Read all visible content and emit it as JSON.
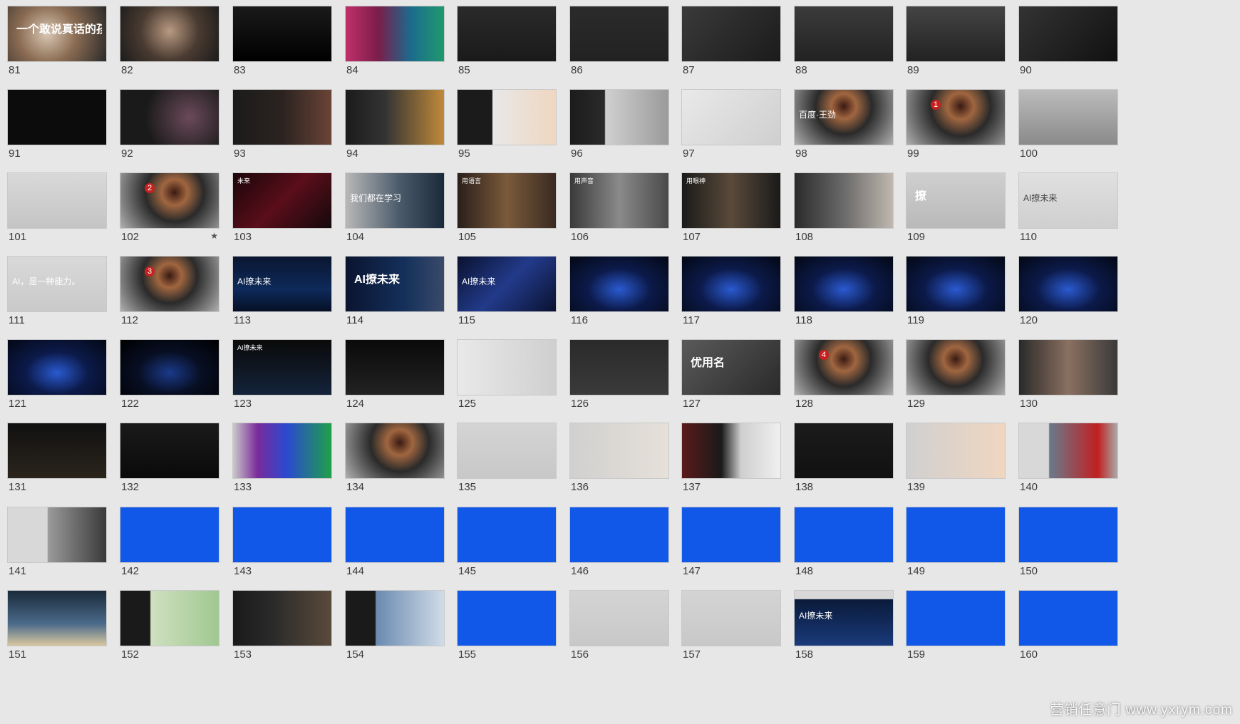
{
  "watermark": "营销任意门 www.yxrym.com",
  "slides": [
    {
      "num": "81",
      "bg": "radial-gradient(circle at 40% 50%, #d9c7b3 0%, #8a6b52 45%, #2a2a2a 100%)",
      "text": "一个敢说真话的孩子",
      "cls": "big"
    },
    {
      "num": "82",
      "bg": "radial-gradient(circle at 50% 45%, #b89a82 0%, #4a3b31 50%, #1b1b1b 100%)",
      "text": "",
      "cls": ""
    },
    {
      "num": "83",
      "bg": "linear-gradient(180deg,#1a1a1a,#000)",
      "text": "",
      "cls": ""
    },
    {
      "num": "84",
      "bg": "linear-gradient(90deg,#c0306a 0%,#7b1d4a 33%,#1c6a8e 66%,#1f9a6c 100%)",
      "text": "",
      "cls": ""
    },
    {
      "num": "85",
      "bg": "linear-gradient(180deg,#2a2a2a,#1a1a1a)",
      "text": "",
      "cls": ""
    },
    {
      "num": "86",
      "bg": "linear-gradient(180deg,#2b2b2b,#222)",
      "text": "",
      "cls": ""
    },
    {
      "num": "87",
      "bg": "linear-gradient(135deg,#3a3a3a,#1b1b1b)",
      "text": "",
      "cls": ""
    },
    {
      "num": "88",
      "bg": "linear-gradient(180deg,#3b3b3b,#222)",
      "text": "",
      "cls": ""
    },
    {
      "num": "89",
      "bg": "linear-gradient(180deg,#444,#222)",
      "text": "",
      "cls": ""
    },
    {
      "num": "90",
      "bg": "linear-gradient(135deg,#333,#111)",
      "text": "",
      "cls": ""
    },
    {
      "num": "91",
      "bg": "#0c0c0c",
      "text": "",
      "cls": ""
    },
    {
      "num": "92",
      "bg": "radial-gradient(circle at 70% 50%, #6b4a5a 0%, #1a1a1a 60%)",
      "text": "",
      "cls": ""
    },
    {
      "num": "93",
      "bg": "linear-gradient(90deg,#1b1b1b 0%,#2b2320 50%,#6a4436 100%)",
      "text": "",
      "cls": ""
    },
    {
      "num": "94",
      "bg": "linear-gradient(90deg,#1b1b1b 0%,#333 40%,#c18a3a 100%)",
      "text": "",
      "cls": ""
    },
    {
      "num": "95",
      "bg": "linear-gradient(90deg,#1b1b1b 0%,#1b1b1b 35%,#e8e8e8 36%,#f0d6c0 100%)",
      "text": "",
      "cls": ""
    },
    {
      "num": "96",
      "bg": "linear-gradient(90deg,#1c1c1c 0%,#2a2a2a 35%,#d0d0d0 36%,#9a9a9a 100%)",
      "text": "",
      "cls": ""
    },
    {
      "num": "97",
      "bg": "linear-gradient(135deg,#e9e9e9,#cfcfcf)",
      "text": "",
      "cls": ""
    },
    {
      "num": "98",
      "bg": "radial-gradient(circle at 50% 30%, #3a1a12 0%, #a06640 20%, #2a2a2a 45%, #b0b0b0 100%)",
      "text": "百度·王劲",
      "cls": "mid"
    },
    {
      "num": "99",
      "bg": "radial-gradient(circle at 55% 30%, #3a1a12 0%, #a06640 20%, #2a2a2a 45%, #b0b0b0 100%)",
      "text": "",
      "cls": "",
      "badge": "1"
    },
    {
      "num": "100",
      "bg": "linear-gradient(180deg,#bcbcbc,#8a8a8a)",
      "text": "",
      "cls": ""
    },
    {
      "num": "101",
      "bg": "linear-gradient(180deg,#d9d9d9,#c4c4c4)",
      "text": "",
      "cls": ""
    },
    {
      "num": "102",
      "bg": "radial-gradient(circle at 55% 35%, #3a1a12 0%, #a06640 20%, #2a2a2a 45%, #b0b0b0 100%)",
      "text": "",
      "cls": "",
      "badge": "2",
      "star": "★"
    },
    {
      "num": "103",
      "bg": "linear-gradient(135deg,#1a0508 0%,#5a0e1a 50%,#14090c 100%)",
      "text": "未来",
      "cls": ""
    },
    {
      "num": "104",
      "bg": "linear-gradient(90deg,#b8b8b8 0%,#4a5a6a 55%,#1a2a3a 100%)",
      "text": "我们都在学习",
      "cls": "mid"
    },
    {
      "num": "105",
      "bg": "linear-gradient(90deg,#2a1f1a 0%,#7a5a3a 50%,#3a2a22 100%)",
      "text": "用语言",
      "cls": ""
    },
    {
      "num": "106",
      "bg": "linear-gradient(90deg,#3a3a3a,#8a8a8a,#4a4a4a)",
      "text": "用声音",
      "cls": ""
    },
    {
      "num": "107",
      "bg": "linear-gradient(90deg,#1a1a1a,#5a4a3a,#1a1a1a)",
      "text": "用眼神",
      "cls": ""
    },
    {
      "num": "108",
      "bg": "linear-gradient(90deg,#2a2a2a,#6a6a6a,#c0b8b0)",
      "text": "",
      "cls": ""
    },
    {
      "num": "109",
      "bg": "linear-gradient(180deg,#cfcfcf,#b9b9b9)",
      "text": "撩",
      "cls": "big"
    },
    {
      "num": "110",
      "bg": "linear-gradient(180deg,#e0e0e0,#cfcfcf)",
      "text": "AI撩未来",
      "cls": "mid dark"
    },
    {
      "num": "111",
      "bg": "linear-gradient(180deg,#d9d9d9,#c9c9c9)",
      "text": "AI，是一种能力。",
      "cls": "mid"
    },
    {
      "num": "112",
      "bg": "radial-gradient(circle at 50% 35%, #3a1a12 0%, #a06640 20%, #2a2a2a 45%, #b0b0b0 100%)",
      "text": "",
      "cls": "",
      "badge": "3"
    },
    {
      "num": "113",
      "bg": "linear-gradient(180deg,#0a1630,#0d2a5a 60%,#061024)",
      "text": "AI撩未来",
      "cls": "mid"
    },
    {
      "num": "114",
      "bg": "linear-gradient(90deg,#0a1430 0%,#14305a 60%,#3a4a6a 100%)",
      "text": "AI撩未来",
      "cls": "big"
    },
    {
      "num": "115",
      "bg": "linear-gradient(135deg,#0a1230,#223a8a,#0a1230)",
      "text": "AI撩未来",
      "cls": "mid"
    },
    {
      "num": "116",
      "bg": "radial-gradient(ellipse at 50% 60%, #2a5ad0 0%, #0c1a4a 45%, #030814 100%)",
      "text": "",
      "cls": ""
    },
    {
      "num": "117",
      "bg": "radial-gradient(ellipse at 50% 60%, #2a5ad0 0%, #0c1a4a 45%, #030814 100%)",
      "text": "",
      "cls": ""
    },
    {
      "num": "118",
      "bg": "radial-gradient(ellipse at 50% 60%, #2a5ad0 0%, #0c1a4a 45%, #030814 100%)",
      "text": "",
      "cls": ""
    },
    {
      "num": "119",
      "bg": "radial-gradient(ellipse at 50% 60%, #2a5ad0 0%, #0c1a4a 45%, #030814 100%)",
      "text": "",
      "cls": ""
    },
    {
      "num": "120",
      "bg": "radial-gradient(ellipse at 50% 60%, #2a5ad0 0%, #0c1a4a 45%, #030814 100%)",
      "text": "",
      "cls": ""
    },
    {
      "num": "121",
      "bg": "radial-gradient(ellipse at 50% 60%, #2a5ad0 0%, #0c1a4a 45%, #030814 100%)",
      "text": "",
      "cls": ""
    },
    {
      "num": "122",
      "bg": "radial-gradient(ellipse at 50% 60%, #1a3a8a 0%, #080f24 45%, #000 100%)",
      "text": "",
      "cls": ""
    },
    {
      "num": "123",
      "bg": "linear-gradient(180deg,#0a0a0a,#14233a)",
      "text": "AI撩未来",
      "cls": ""
    },
    {
      "num": "124",
      "bg": "linear-gradient(180deg,#0a0a0a,#222)",
      "text": "",
      "cls": ""
    },
    {
      "num": "125",
      "bg": "linear-gradient(90deg,#e9e9e9,#cfcfcf)",
      "text": "",
      "cls": ""
    },
    {
      "num": "126",
      "bg": "linear-gradient(180deg,#2a2a2a,#3a3a3a)",
      "text": "",
      "cls": ""
    },
    {
      "num": "127",
      "bg": "linear-gradient(135deg,#5a5a5a,#2a2a2a)",
      "text": "优用名",
      "cls": "big"
    },
    {
      "num": "128",
      "bg": "radial-gradient(circle at 50% 35%, #3a1a12 0%, #a06640 20%, #2a2a2a 45%, #b0b0b0 100%)",
      "text": "",
      "cls": "",
      "badge": "4"
    },
    {
      "num": "129",
      "bg": "radial-gradient(circle at 50% 35%, #3a1a12 0%, #a06640 20%, #2a2a2a 45%, #b0b0b0 100%)",
      "text": "",
      "cls": ""
    },
    {
      "num": "130",
      "bg": "linear-gradient(90deg,#2a2a2a,#8a7060,#3a3a3a)",
      "text": "",
      "cls": ""
    },
    {
      "num": "131",
      "bg": "linear-gradient(180deg,#111,#2a241c)",
      "text": "",
      "cls": ""
    },
    {
      "num": "132",
      "bg": "linear-gradient(180deg,#1a1a1a,#0a0a0a)",
      "text": "",
      "cls": ""
    },
    {
      "num": "133",
      "bg": "linear-gradient(90deg,#c9c9c9 0%,#7a2a9a 25%,#2a4ad0 55%,#1fa04a 100%)",
      "text": "",
      "cls": ""
    },
    {
      "num": "134",
      "bg": "radial-gradient(circle at 55% 35%, #3a1a12 0%, #a06640 20%, #2a2a2a 45%, #b0b0b0 100%)",
      "text": "",
      "cls": ""
    },
    {
      "num": "135",
      "bg": "linear-gradient(180deg,#d4d4d4,#c8c8c8)",
      "text": "",
      "cls": ""
    },
    {
      "num": "136",
      "bg": "linear-gradient(90deg,#d0d0d0,#e6e0d8)",
      "text": "",
      "cls": ""
    },
    {
      "num": "137",
      "bg": "linear-gradient(90deg,#5a1a1a,#1a1a1a 40%,#cfcfcf 60%,#f0f0f0)",
      "text": "",
      "cls": ""
    },
    {
      "num": "138",
      "bg": "linear-gradient(180deg,#1b1b1b,#111)",
      "text": "",
      "cls": ""
    },
    {
      "num": "139",
      "bg": "linear-gradient(90deg,#d0d0d0,#f0d6c0)",
      "text": "",
      "cls": ""
    },
    {
      "num": "140",
      "bg": "linear-gradient(90deg,#d8d8d8 0%,#d8d8d8 30%,#6a7a8a 31%,#c02020 80%,#aaa 100%)",
      "text": "",
      "cls": ""
    },
    {
      "num": "141",
      "bg": "linear-gradient(90deg,#d8d8d8 0%,#d8d8d8 40%,#9a9a9a 41%,#3a3a3a 100%)",
      "text": "",
      "cls": ""
    },
    {
      "num": "142",
      "bg": "#1258e8",
      "text": "",
      "cls": ""
    },
    {
      "num": "143",
      "bg": "#1258e8",
      "text": "",
      "cls": ""
    },
    {
      "num": "144",
      "bg": "#1258e8",
      "text": "",
      "cls": ""
    },
    {
      "num": "145",
      "bg": "#1258e8",
      "text": "",
      "cls": ""
    },
    {
      "num": "146",
      "bg": "#1258e8",
      "text": "",
      "cls": ""
    },
    {
      "num": "147",
      "bg": "#1258e8",
      "text": "",
      "cls": ""
    },
    {
      "num": "148",
      "bg": "#1258e8",
      "text": "",
      "cls": ""
    },
    {
      "num": "149",
      "bg": "#1258e8",
      "text": "",
      "cls": ""
    },
    {
      "num": "150",
      "bg": "#1258e8",
      "text": "",
      "cls": ""
    },
    {
      "num": "151",
      "bg": "linear-gradient(180deg,#1a2a3a,#4a6a8a 60%,#d9c8a0)",
      "text": "",
      "cls": ""
    },
    {
      "num": "152",
      "bg": "linear-gradient(90deg,#1a1a1a 0%,#1a1a1a 30%,#cfe0c0 31%,#a0c890 100%)",
      "text": "",
      "cls": ""
    },
    {
      "num": "153",
      "bg": "linear-gradient(90deg,#1a1a1a 0%,#2a2a2a 40%,#5a4a3a 100%)",
      "text": "",
      "cls": ""
    },
    {
      "num": "154",
      "bg": "linear-gradient(90deg,#1a1a1a 0%,#1a1a1a 30%,#6a8ab0 31%,#d0dce8 100%)",
      "text": "",
      "cls": ""
    },
    {
      "num": "155",
      "bg": "#1258e8",
      "text": "",
      "cls": ""
    },
    {
      "num": "156",
      "bg": "linear-gradient(180deg,#d4d4d4,#c8c8c8)",
      "text": "",
      "cls": ""
    },
    {
      "num": "157",
      "bg": "linear-gradient(180deg,#d4d4d4,#c8c8c8)",
      "text": "",
      "cls": ""
    },
    {
      "num": "158",
      "bg": "linear-gradient(180deg,#d8d8d8 0%,#d8d8d8 15%,#0a1a3a 16%,#1a3a7a 100%)",
      "text": "AI撩未来",
      "cls": "mid"
    },
    {
      "num": "159",
      "bg": "#1258e8",
      "text": "",
      "cls": ""
    },
    {
      "num": "160",
      "bg": "#1258e8",
      "text": "",
      "cls": ""
    }
  ]
}
